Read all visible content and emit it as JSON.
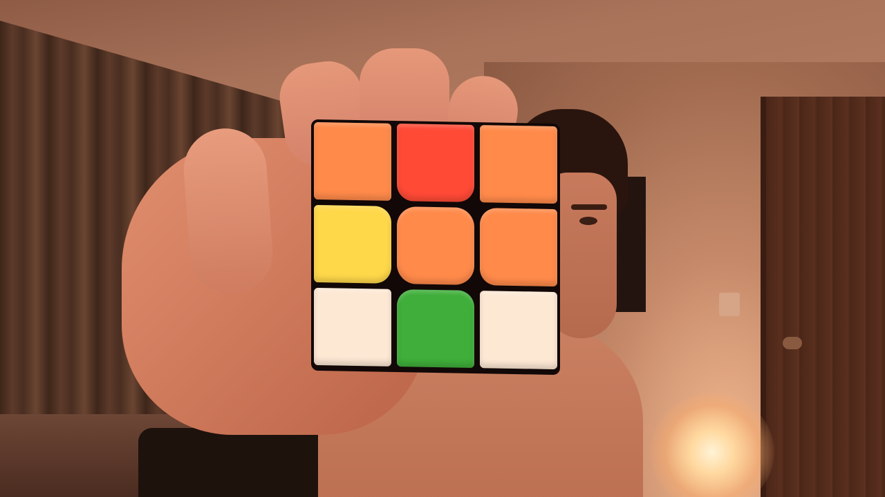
{
  "scene": {
    "description_type": "photo",
    "cube_face_colors": [
      [
        "orange",
        "red",
        "orange"
      ],
      [
        "yellow",
        "orange",
        "orange"
      ],
      [
        "white",
        "green",
        "white"
      ]
    ],
    "colors": {
      "orange": "#ff8a4a",
      "red": "#ff4a36",
      "yellow": "#ffd84a",
      "white": "#fde8d4",
      "green": "#3fae3a"
    }
  }
}
